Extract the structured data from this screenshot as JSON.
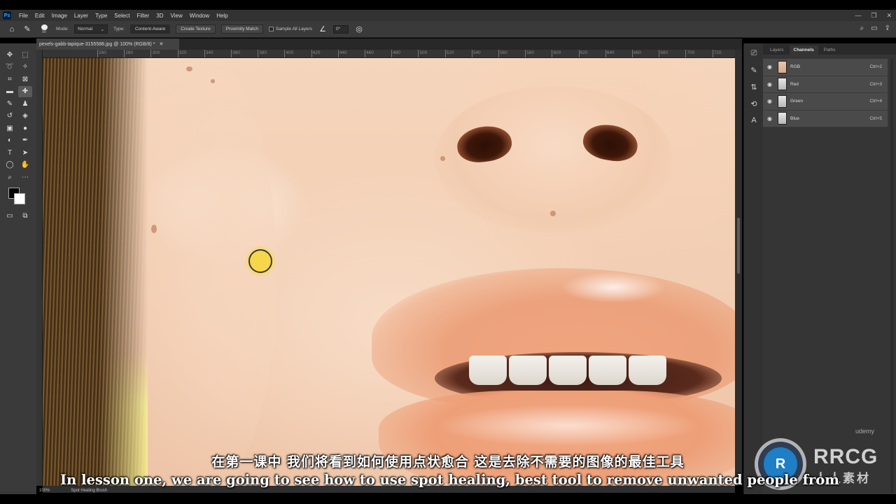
{
  "app": {
    "logo_text": "Ps"
  },
  "menu": [
    "File",
    "Edit",
    "Image",
    "Layer",
    "Type",
    "Select",
    "Filter",
    "3D",
    "View",
    "Window",
    "Help"
  ],
  "window_controls": {
    "minimize": "—",
    "restore": "❐",
    "close": "✕"
  },
  "options_bar": {
    "brush_size": "50",
    "mode_label": "Mode:",
    "mode_value": "Normal",
    "type_label": "Type:",
    "type_buttons": [
      "Content-Aware",
      "Create Texture",
      "Proximity Match"
    ],
    "sample_all_layers": "Sample All Layers",
    "angle_value": "0°"
  },
  "document": {
    "tab_title": "pexels-gabb-tapique-3155588.jpg @ 100% (RGB/8) *",
    "close_glyph": "✕"
  },
  "ruler_top_ticks": [
    "260",
    "280",
    "300",
    "320",
    "340",
    "360",
    "380",
    "400",
    "420",
    "440",
    "460",
    "480",
    "500",
    "520",
    "540",
    "560",
    "580",
    "600",
    "620",
    "640",
    "660",
    "680",
    "700",
    "720"
  ],
  "status": {
    "zoom": "100%",
    "tool_name": "Spot Healing Brush"
  },
  "panel": {
    "tabs": [
      "Layers",
      "Channels",
      "Paths"
    ],
    "active_tab": "Channels",
    "channels": [
      {
        "name": "RGB",
        "shortcut": "Ctrl+2"
      },
      {
        "name": "Red",
        "shortcut": "Ctrl+3"
      },
      {
        "name": "Green",
        "shortcut": "Ctrl+4"
      },
      {
        "name": "Blue",
        "shortcut": "Ctrl+5"
      }
    ]
  },
  "subtitles": {
    "chinese": "在第一课中 我们将看到如何使用点状愈合 这是去除不需要的图像的最佳工具",
    "english": "In lesson one, we are going to see how to use spot healing, best tool to remove unwanted people from"
  },
  "watermark": {
    "brand": "RRCG",
    "sub": "人人素材",
    "udemy": "udemy"
  }
}
